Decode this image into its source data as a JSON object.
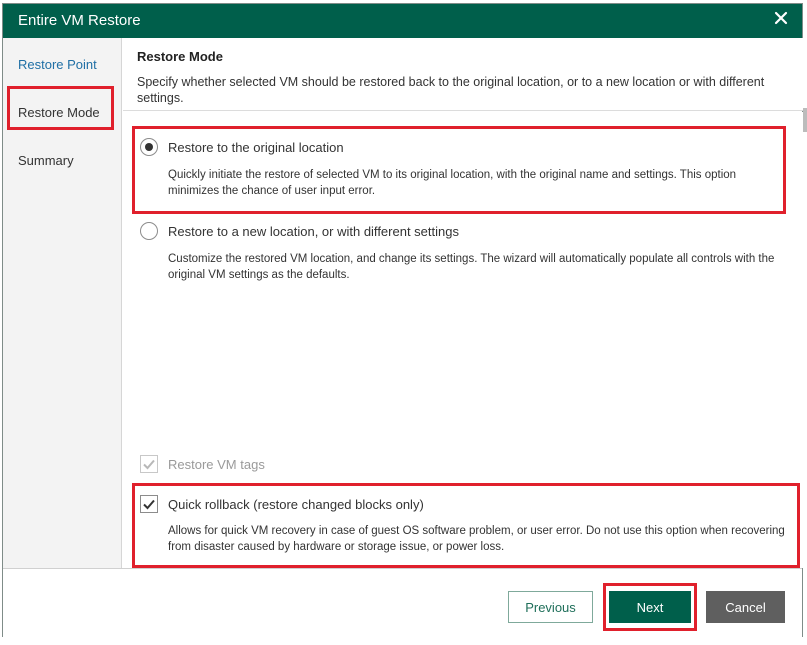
{
  "window": {
    "title": "Entire VM Restore",
    "close_icon": "close-icon"
  },
  "sidebar": {
    "items": [
      {
        "label": "Restore Point",
        "state": "link"
      },
      {
        "label": "Restore Mode",
        "state": "current"
      },
      {
        "label": "Summary",
        "state": "plain"
      }
    ]
  },
  "header": {
    "title": "Restore Mode",
    "description": "Specify whether selected VM should be restored back to the original location, or to a new location or with different settings."
  },
  "options": {
    "original": {
      "label": "Restore to the original location",
      "description": "Quickly initiate the restore of selected VM to its original location, with the original name and settings. This option minimizes the chance of user input error.",
      "selected": true
    },
    "new_location": {
      "label": "Restore to a new location, or with different settings",
      "description": "Customize the restored VM location, and change its settings. The wizard will automatically populate all controls with the original VM settings as the defaults.",
      "selected": false
    }
  },
  "checkboxes": {
    "restore_tags": {
      "label": "Restore VM tags",
      "checked": true,
      "disabled": true
    },
    "quick_rollback": {
      "label": "Quick rollback (restore changed blocks only)",
      "checked": true,
      "description": "Allows for quick VM recovery in case of guest OS software problem, or user error. Do not use this option when recovering from disaster caused by hardware or storage issue, or power loss."
    }
  },
  "footer": {
    "previous_label": "Previous",
    "next_label": "Next",
    "cancel_label": "Cancel"
  },
  "colors": {
    "brand": "#005f4b",
    "highlight": "#e0202c",
    "link": "#1f6fa5",
    "cancel": "#5f5f5f"
  }
}
